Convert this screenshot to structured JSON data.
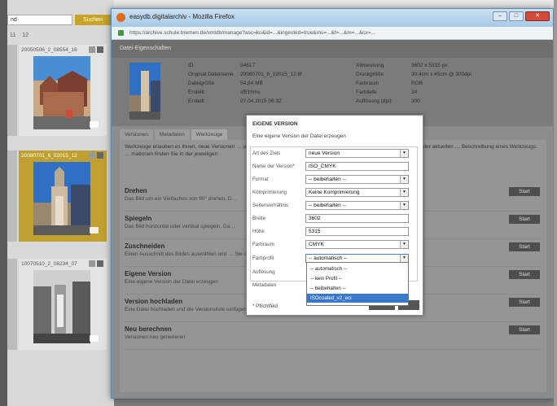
{
  "background": {
    "search_value": "nd",
    "search_button": "Suchen",
    "pager": [
      "11",
      "12"
    ],
    "thumbs": [
      {
        "caption": "20050506_2_08554_16",
        "selected": false
      },
      {
        "caption": "20080701_6_02015_12",
        "selected": true
      },
      {
        "caption": "10070510_2_08234_07",
        "selected": false
      }
    ]
  },
  "window": {
    "title": "easydb.digitalarchiv - Mozilla Firefox",
    "url": "https://archive.schule.bremen.de/xmldb/manage?asc=ko&id=...&ingested=true&ms=...&f=...&m=...&cx=...",
    "header_title": "Datei-Eigenschaften"
  },
  "info": {
    "left": [
      {
        "label": "ID",
        "value": "34617"
      },
      {
        "label": "Original Dateiname",
        "value": "20080701_6_02015_12.tif"
      },
      {
        "label": "Dateigröße",
        "value": "54,84 MB"
      },
      {
        "label": "Erstellt",
        "value": "sf51hms"
      },
      {
        "label": "Erstellt",
        "value": "07.04.2015 06:32"
      }
    ],
    "right": [
      {
        "label": "Abmessung",
        "value": "3602 x 5315 px"
      },
      {
        "label": "Druckgröße",
        "value": "30,4cm x 45cm @ 300dpi"
      },
      {
        "label": "Farbraum",
        "value": "RGB"
      },
      {
        "label": "Farbtiefe",
        "value": "24"
      },
      {
        "label": "Auflösung (dpi)",
        "value": "300"
      }
    ]
  },
  "tabs": [
    "Versionen",
    "Metadaten",
    "Werkzeuge"
  ],
  "intro": "Werkzeuge erlauben es Ihnen, neue Versionen … oder beschneiden. Das Ergebnis eines Werkzeuges kann eine neue Version der aktuellen … Beschreibung eines Werkzeugs. … mationen finden Sie in der jeweiligen",
  "tools": [
    {
      "title": "Drehen",
      "desc": "Das Bild um ein Vielfaches von 90° drehen. D…",
      "button": "Start"
    },
    {
      "title": "Spiegeln",
      "desc": "Das Bild horizontal oder vertikal spiegeln. Da…",
      "button": "Start"
    },
    {
      "title": "Zuschneiden",
      "desc": "Einen Ausschnitt des Bildes auswählen und … Sie dafür einen Bereich und …zeugen.",
      "button": "Start"
    },
    {
      "title": "Eigene Version",
      "desc": "Eine eigene Version der Datei erzeugen",
      "button": "Start"
    },
    {
      "title": "Version hochladen",
      "desc": "Eine Datei hochladen und die Versionsliste einfügen",
      "button": "Start"
    },
    {
      "title": "Neu berechnen",
      "desc": "Versionen neu generieren",
      "button": "Start"
    }
  ],
  "modal": {
    "title": "EIGENE VERSION",
    "subtitle": "Eine eigene Version der Datei erzeugen",
    "fields": [
      {
        "label": "Art des Ziels",
        "value": "neue Version",
        "select": true
      },
      {
        "label": "Name der Version*",
        "value": "ISO_CMYK",
        "select": false
      },
      {
        "label": "Format",
        "value": "-- beibehalten --",
        "select": true
      },
      {
        "label": "Komprimierung",
        "value": "Keine Komprimierung",
        "select": true
      },
      {
        "label": "Seitenverhältnis",
        "value": "-- beibehalten --",
        "select": true
      },
      {
        "label": "Breite",
        "value": "3602",
        "select": false
      },
      {
        "label": "Höhe",
        "value": "5315",
        "select": false
      },
      {
        "label": "Farbraum",
        "value": "CMYK",
        "select": true
      },
      {
        "label": "Farbprofil",
        "value": "-- automatisch --",
        "select": true,
        "open": true
      },
      {
        "label": "Auflösung",
        "value": "",
        "select": false
      },
      {
        "label": "Metadaten",
        "value": "",
        "select": false
      }
    ],
    "dropdown_options": [
      "-- automatisch --",
      "-- kein Profil --",
      "-- beibehalten --",
      "ISOcoated_v2_eci"
    ],
    "dropdown_selected_index": 3,
    "required_note": "* Pflichtfeld"
  }
}
